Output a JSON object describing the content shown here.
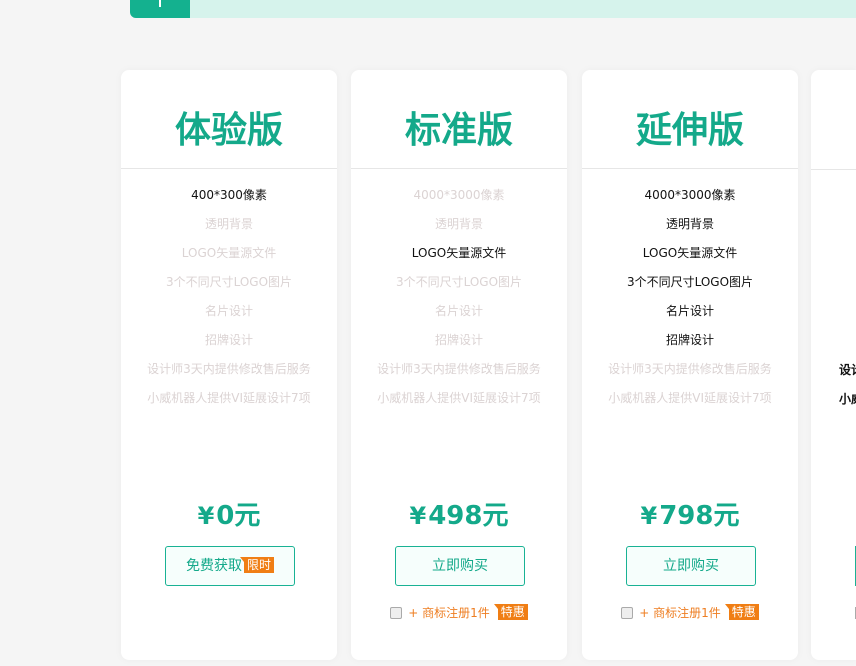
{
  "plans": [
    {
      "title": "体验版",
      "features": [
        {
          "label": "400*300像素",
          "on": true
        },
        {
          "label": "透明背景",
          "on": false
        },
        {
          "label": "LOGO矢量源文件",
          "on": false
        },
        {
          "label": "3个不同尺寸LOGO图片",
          "on": false
        },
        {
          "label": "名片设计",
          "on": false
        },
        {
          "label": "招牌设计",
          "on": false
        },
        {
          "label": "设计师3天内提供修改售后服务",
          "on": false
        },
        {
          "label": "小威机器人提供VI延展设计7项",
          "on": false
        }
      ],
      "price_symbol": "¥",
      "price": "0元",
      "button_label": "免费获取",
      "button_tag": "限时"
    },
    {
      "title": "标准版",
      "features": [
        {
          "label": "4000*3000像素",
          "on": false
        },
        {
          "label": "透明背景",
          "on": false
        },
        {
          "label": "LOGO矢量源文件",
          "on": true
        },
        {
          "label": "3个不同尺寸LOGO图片",
          "on": false
        },
        {
          "label": "名片设计",
          "on": false
        },
        {
          "label": "招牌设计",
          "on": false
        },
        {
          "label": "设计师3天内提供修改售后服务",
          "on": false
        },
        {
          "label": "小威机器人提供VI延展设计7项",
          "on": false
        }
      ],
      "price_symbol": "¥",
      "price": "498元",
      "button_label": "立即购买",
      "addon_label": "+ 商标注册1件",
      "addon_tag": "特惠"
    },
    {
      "title": "延伸版",
      "features": [
        {
          "label": "4000*3000像素",
          "on": true
        },
        {
          "label": "透明背景",
          "on": true
        },
        {
          "label": "LOGO矢量源文件",
          "on": true
        },
        {
          "label": "3个不同尺寸LOGO图片",
          "on": true
        },
        {
          "label": "名片设计",
          "on": true
        },
        {
          "label": "招牌设计",
          "on": true
        },
        {
          "label": "设计师3天内提供修改售后服务",
          "on": false
        },
        {
          "label": "小威机器人提供VI延展设计7项",
          "on": false
        }
      ],
      "price_symbol": "¥",
      "price": "798元",
      "button_label": "立即购买",
      "addon_label": "+ 商标注册1件",
      "addon_tag": "特惠"
    }
  ],
  "partial_plan": {
    "feature_1": "设计",
    "feature_2": "小威"
  },
  "colors": {
    "accent": "#14a98a",
    "tag": "#f07e14",
    "disabled_text": "#dbd3d3"
  }
}
